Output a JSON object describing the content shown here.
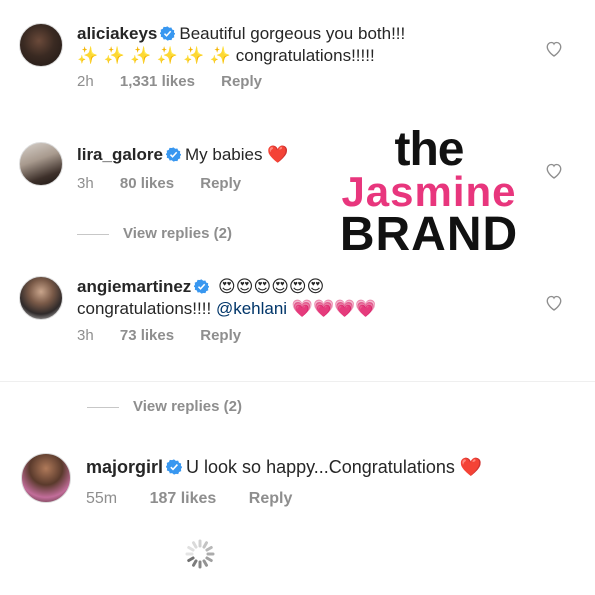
{
  "comments": [
    {
      "username": "aliciakeys",
      "text_line1": "Beautiful gorgeous you both!!!",
      "text_line2_emoji": "✨ ✨ ✨ ✨ ✨ ✨",
      "text_line2": "congratulations!!!!!",
      "time": "2h",
      "likes": "1,331 likes",
      "reply": "Reply"
    },
    {
      "username": "lira_galore",
      "text": "My babies",
      "emoji": "❤️",
      "time": "3h",
      "likes": "80 likes",
      "reply": "Reply",
      "view_replies": "View replies (2)"
    },
    {
      "username": "angiemartinez",
      "emoji_line1": "😍😍😍😍😍😍",
      "text_line2": "congratulations!!!!",
      "mention": "@kehlani",
      "emoji_line2": "💗💗💗💗",
      "time": "3h",
      "likes": "73 likes",
      "reply": "Reply",
      "view_replies": "View replies (2)"
    },
    {
      "username": "majorgirl",
      "text": "U look so happy...Congratulations",
      "emoji": "❤️",
      "time": "55m",
      "likes": "187 likes",
      "reply": "Reply"
    }
  ],
  "watermark": {
    "line1": "the",
    "line2": "Jasmine",
    "line3": "BRAND"
  },
  "icons": {
    "verified": "verified-badge-icon",
    "like": "heart-outline-icon",
    "loading": "loading-spinner-icon"
  },
  "colors": {
    "verified": "#3897f0",
    "meta_text": "#8e8e8e",
    "brand_pink": "#e8367d",
    "heart_red": "#ed4956"
  }
}
